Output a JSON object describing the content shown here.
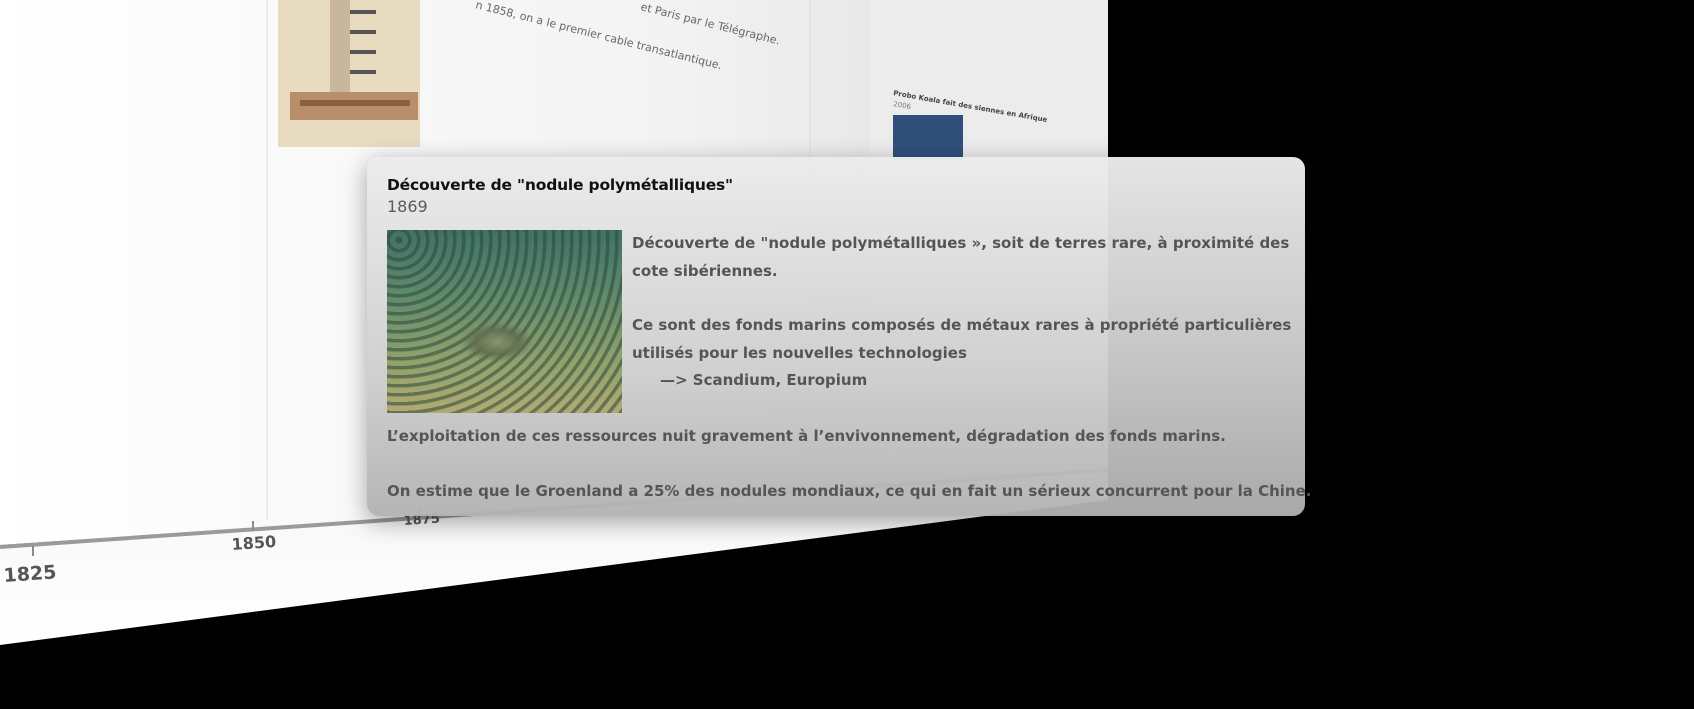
{
  "timeline": {
    "axis_ticks": [
      "1825",
      "1850",
      "1875"
    ]
  },
  "background_card": {
    "text_line_1": "et Paris par le Télégraphe.",
    "text_line_2": "n 1858, on a le premier cable transatlantique."
  },
  "side_panel": {
    "item_title": "Probo Koala fait des siennes en Afrique",
    "item_year": "2006"
  },
  "popup": {
    "title": "Découverte de \"nodule polymétalliques\"",
    "year": "1869",
    "image_icon": "seafloor-nodules-photo",
    "paragraph_1": "Découverte de \"nodule polymétalliques », soit de terres rare, à proximité des cote sibériennes.",
    "paragraph_2": "Ce sont des fonds marins composés de métaux rares à propriété particulières utilisés pour les nouvelles technologies",
    "paragraph_2_list": "—> Scandium, Europium",
    "paragraph_3": "L’exploitation de ces ressources nuit gravement à l’envivonnement, dégradation des fonds marins.",
    "paragraph_4": "On estime que le Groenland a 25% des nodules mondiaux, ce qui en fait un sérieux concurrent pour la Chine."
  }
}
